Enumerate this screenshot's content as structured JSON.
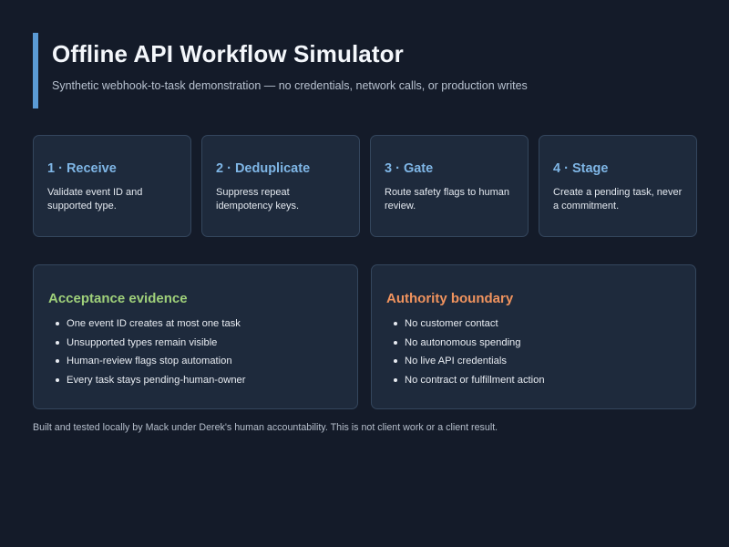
{
  "header": {
    "title": "Offline API Workflow Simulator",
    "subtitle": "Synthetic webhook-to-task demonstration — no credentials, network calls, or production writes"
  },
  "steps": [
    {
      "title": "1 · Receive",
      "description": "Validate event ID and supported type."
    },
    {
      "title": "2 · Deduplicate",
      "description": "Suppress repeat idempotency keys."
    },
    {
      "title": "3 · Gate",
      "description": "Route safety flags to human review."
    },
    {
      "title": "4 · Stage",
      "description": "Create a pending task, never a commitment."
    }
  ],
  "acceptance": {
    "title": "Acceptance evidence",
    "color": "#9fd07a",
    "items": [
      "One event ID creates at most one task",
      "Unsupported types remain visible",
      "Human-review flags stop automation",
      "Every task stays pending-human-owner"
    ]
  },
  "authority": {
    "title": "Authority boundary",
    "color": "#f0935e",
    "items": [
      "No customer contact",
      "No autonomous spending",
      "No live API credentials",
      "No contract or fulfillment action"
    ]
  },
  "footer": {
    "text": "Built and tested locally by Mack under Derek's human accountability. This is not client work or a client result."
  },
  "colors": {
    "accent": "#5b9bd5",
    "step_title": "#7fb6e6",
    "background": "#141b29",
    "card": "#1e2a3c"
  }
}
